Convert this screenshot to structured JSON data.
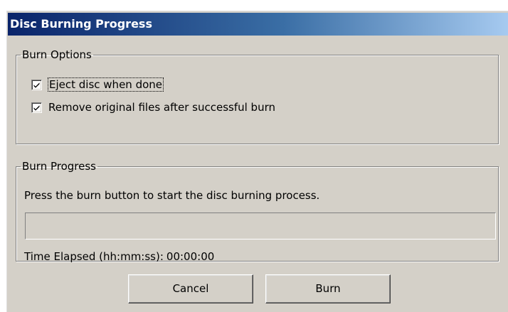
{
  "window": {
    "title": "Disc Burning Progress"
  },
  "burn_options": {
    "legend": "Burn Options",
    "options": [
      {
        "label": "Eject disc when done",
        "checked": true,
        "focused": true
      },
      {
        "label": "Remove original files after successful burn",
        "checked": true,
        "focused": false
      }
    ]
  },
  "burn_progress": {
    "legend": "Burn Progress",
    "status": "Press the burn button to start the disc burning process.",
    "progress_percent": 0,
    "elapsed_label": "Time Elapsed (hh:mm:ss):",
    "elapsed_value": "00:00:00"
  },
  "buttons": {
    "cancel_label": "Cancel",
    "burn_label": "Burn"
  },
  "colors": {
    "face": "#d4d0c8",
    "titlebar_start": "#0a246a",
    "titlebar_end": "#a6caf0",
    "title_text": "#ffffff"
  },
  "icons": {
    "checkmark": "checkmark-icon"
  }
}
